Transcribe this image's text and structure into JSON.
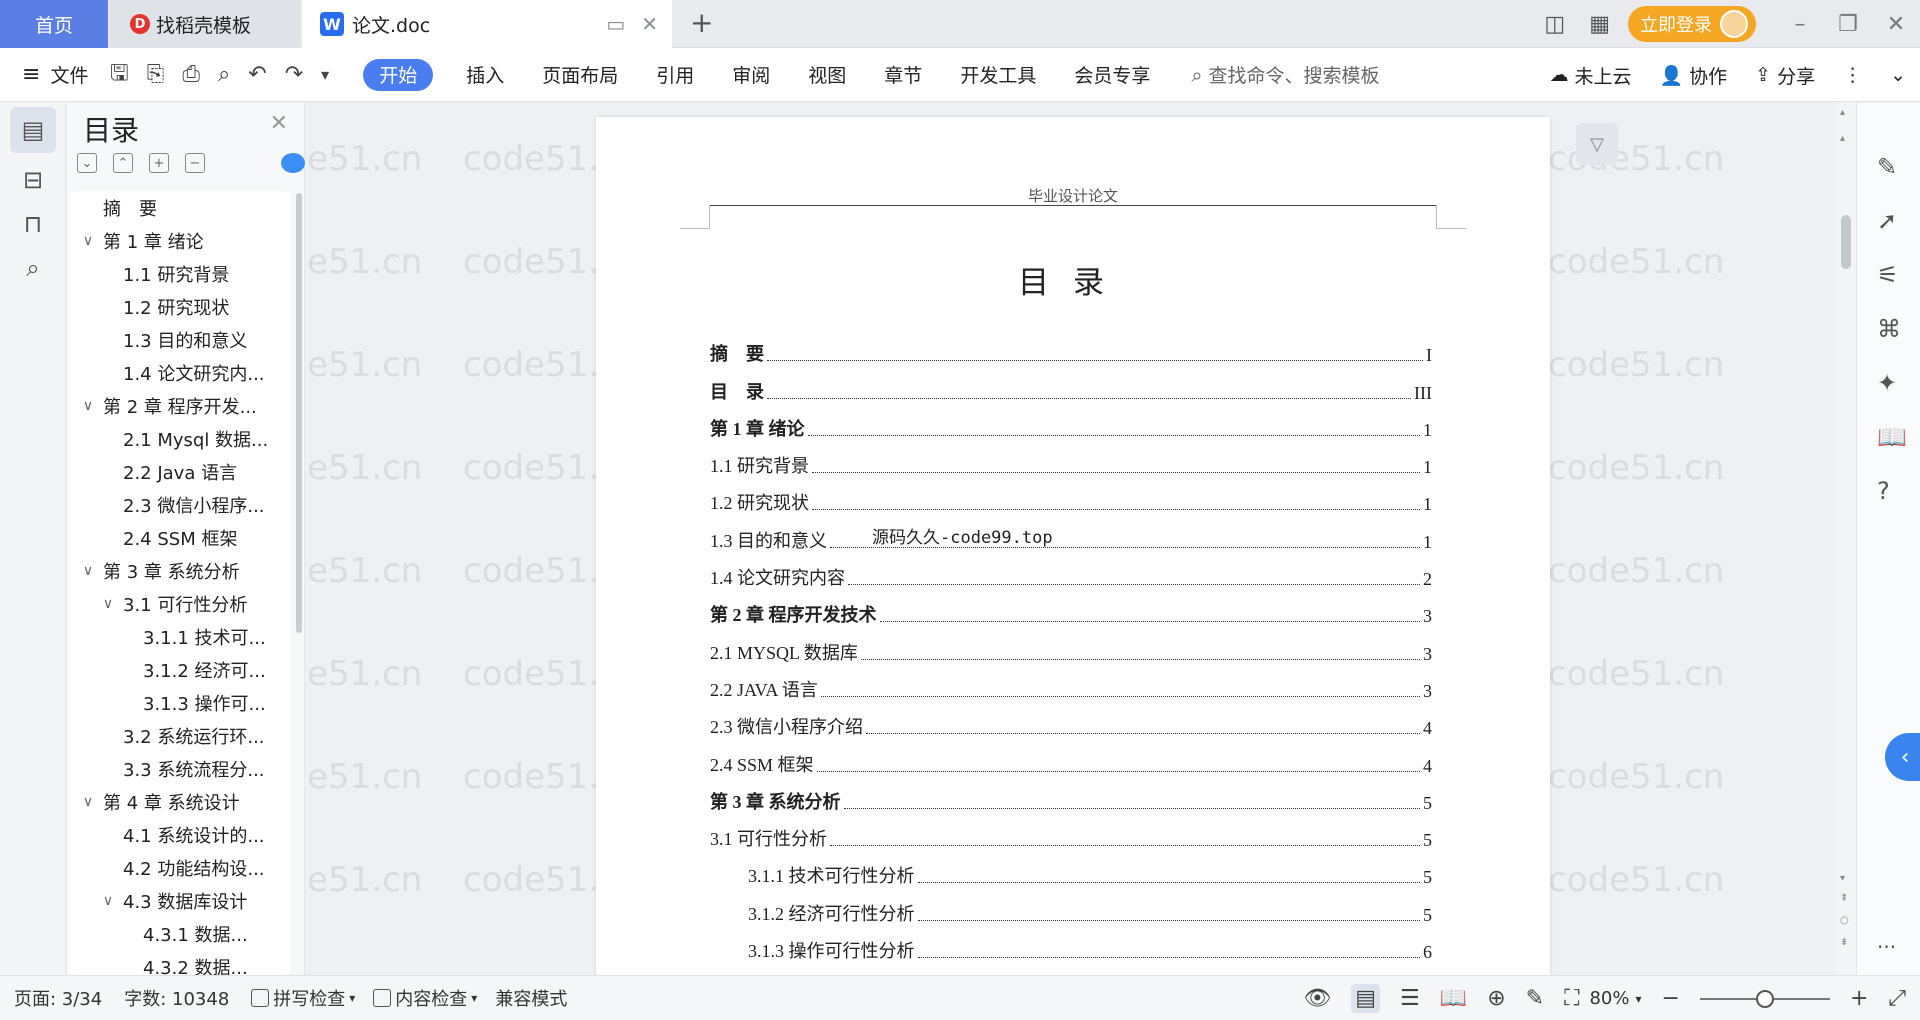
{
  "tabs": {
    "home": "首页",
    "templates": "找稻壳模板",
    "document": "论文.doc",
    "new_tab": "+"
  },
  "titlebar": {
    "login": "立即登录",
    "minimize": "–",
    "restore": "❐",
    "close": "✕"
  },
  "ribbon": {
    "file": "文件",
    "tabs": [
      "开始",
      "插入",
      "页面布局",
      "引用",
      "审阅",
      "视图",
      "章节",
      "开发工具",
      "会员专享"
    ],
    "active_tab": "开始",
    "search_placeholder": "查找命令、搜索模板",
    "cloud": "未上云",
    "collab": "协作",
    "share": "分享"
  },
  "toc_panel": {
    "title": "目录",
    "items": [
      {
        "label": "摘　要",
        "level": 1,
        "expand": ""
      },
      {
        "label": "第 1 章  绪论",
        "level": 1,
        "expand": "down"
      },
      {
        "label": "1.1  研究背景",
        "level": 2,
        "expand": ""
      },
      {
        "label": "1.2  研究现状",
        "level": 2,
        "expand": ""
      },
      {
        "label": "1.3  目的和意义",
        "level": 2,
        "expand": ""
      },
      {
        "label": "1.4  论文研究内...",
        "level": 2,
        "expand": ""
      },
      {
        "label": "第 2 章  程序开发...",
        "level": 1,
        "expand": "down"
      },
      {
        "label": "2.1 Mysql 数据...",
        "level": 2,
        "expand": ""
      },
      {
        "label": "2.2 Java 语言",
        "level": 2,
        "expand": ""
      },
      {
        "label": "2.3  微信小程序...",
        "level": 2,
        "expand": ""
      },
      {
        "label": "2.4 SSM 框架",
        "level": 2,
        "expand": ""
      },
      {
        "label": "第 3 章  系统分析",
        "level": 1,
        "expand": "down"
      },
      {
        "label": "3.1 可行性分析",
        "level": 2,
        "expand": "down"
      },
      {
        "label": "3.1.1 技术可...",
        "level": 3,
        "expand": ""
      },
      {
        "label": "3.1.2 经济可...",
        "level": 3,
        "expand": ""
      },
      {
        "label": "3.1.3 操作可...",
        "level": 3,
        "expand": ""
      },
      {
        "label": "3.2 系统运行环...",
        "level": 2,
        "expand": ""
      },
      {
        "label": "3.3 系统流程分...",
        "level": 2,
        "expand": ""
      },
      {
        "label": "第 4 章  系统设计",
        "level": 1,
        "expand": "down"
      },
      {
        "label": "4.1  系统设计的...",
        "level": 2,
        "expand": ""
      },
      {
        "label": "4.2  功能结构设...",
        "level": 2,
        "expand": ""
      },
      {
        "label": "4.3  数据库设计",
        "level": 2,
        "expand": "down"
      },
      {
        "label": "4.3.1  数据...",
        "level": 3,
        "expand": ""
      },
      {
        "label": "4.3.2  数据...",
        "level": 3,
        "expand": ""
      }
    ]
  },
  "document": {
    "header_text": "毕业设计论文",
    "heading": "目录",
    "overlay_text": "源码久久-code99.top",
    "entries": [
      {
        "label": "摘　要",
        "page": "I",
        "bold": true,
        "level": 1
      },
      {
        "label": "目　录",
        "page": "III",
        "bold": true,
        "level": 1
      },
      {
        "label": "第 1 章  绪论",
        "page": "1",
        "bold": true,
        "level": 1
      },
      {
        "label": "1.1  研究背景",
        "page": "1",
        "bold": false,
        "level": 2
      },
      {
        "label": "1.2  研究现状",
        "page": "1",
        "bold": false,
        "level": 2
      },
      {
        "label": "1.3  目的和意义",
        "page": "1",
        "bold": false,
        "level": 2
      },
      {
        "label": "1.4  论文研究内容",
        "page": "2",
        "bold": false,
        "level": 2
      },
      {
        "label": "第 2 章  程序开发技术",
        "page": "3",
        "bold": true,
        "level": 1
      },
      {
        "label": "2.1 MYSQL 数据库",
        "page": "3",
        "bold": false,
        "level": 2
      },
      {
        "label": "2.2 JAVA 语言",
        "page": "3",
        "bold": false,
        "level": 2
      },
      {
        "label": "2.3  微信小程序介绍",
        "page": "4",
        "bold": false,
        "level": 2
      },
      {
        "label": "2.4 SSM 框架",
        "page": "4",
        "bold": false,
        "level": 2
      },
      {
        "label": "第 3 章  系统分析",
        "page": "5",
        "bold": true,
        "level": 1
      },
      {
        "label": "3.1 可行性分析",
        "page": "5",
        "bold": false,
        "level": 2
      },
      {
        "label": "3.1.1 技术可行性分析",
        "page": "5",
        "bold": false,
        "level": 3
      },
      {
        "label": "3.1.2 经济可行性分析",
        "page": "5",
        "bold": false,
        "level": 3
      },
      {
        "label": "3.1.3 操作可行性分析",
        "page": "6",
        "bold": false,
        "level": 3
      }
    ]
  },
  "watermark_text": "code51.cn",
  "status": {
    "page": "页面: 3/34",
    "words": "字数: 10348",
    "spell_check": "拼写检查",
    "content_check": "内容检查",
    "compat_mode": "兼容模式",
    "zoom": "80%",
    "zoom_level": 0.8
  },
  "colors": {
    "accent": "#4a7ef0",
    "home_tab": "#5b7ee5",
    "login": "#f5a623"
  }
}
